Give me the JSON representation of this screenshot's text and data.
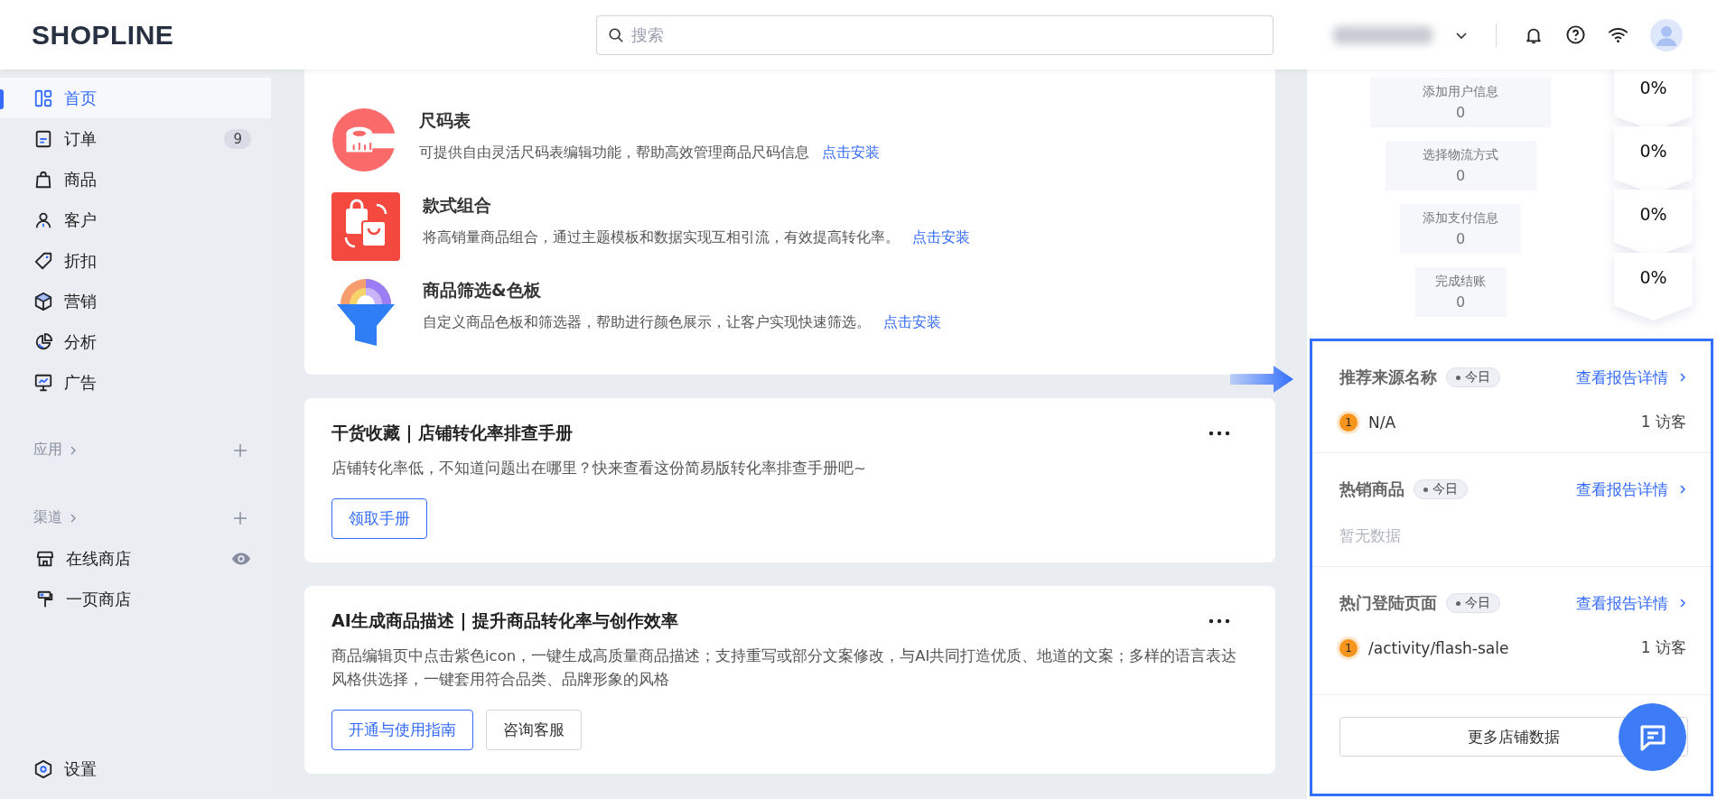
{
  "header": {
    "logo": "SHOPLINE",
    "search": {
      "placeholder": "搜索"
    }
  },
  "sidebar": {
    "items": [
      {
        "label": "首页",
        "selected": true
      },
      {
        "label": "订单",
        "selected": false,
        "badge": "9"
      },
      {
        "label": "商品",
        "selected": false
      },
      {
        "label": "客户",
        "selected": false
      },
      {
        "label": "折扣",
        "selected": false
      },
      {
        "label": "营销",
        "selected": false
      },
      {
        "label": "分析",
        "selected": false
      },
      {
        "label": "广告",
        "selected": false
      }
    ],
    "sections": [
      {
        "label": "应用"
      },
      {
        "label": "渠道",
        "children": [
          {
            "label": "在线商店",
            "preview": true
          },
          {
            "label": "一页商店",
            "preview": false
          }
        ]
      }
    ],
    "settings": "设置"
  },
  "plugins": [
    {
      "title": "尺码表",
      "description": "可提供自由灵活尺码表编辑功能，帮助高效管理商品尺码信息",
      "link": "点击安装"
    },
    {
      "title": "款式组合",
      "description": "将高销量商品组合，通过主题模板和数据实现互相引流，有效提高转化率。",
      "link": "点击安装"
    },
    {
      "title": "商品筛选&色板",
      "description": "自定义商品色板和筛选器，帮助进行颜色展示，让客户实现快速筛选。",
      "link": "点击安装"
    }
  ],
  "articles": [
    {
      "title": "干货收藏 | 店铺转化率排查手册",
      "description": "店铺转化率低，不知道问题出在哪里？快来查看这份简易版转化率排查手册吧~",
      "buttons": [
        {
          "label": "领取手册",
          "kind": "primary"
        }
      ]
    },
    {
      "title": "AI生成商品描述 | 提升商品转化率与创作效率",
      "description": "商品编辑页中点击紫色icon，一键生成高质量商品描述；支持重写或部分文案修改，与AI共同打造优质、地道的文案；多样的语言表达风格供选择，一键套用符合品类、品牌形象的风格",
      "buttons": [
        {
          "label": "开通与使用指南",
          "kind": "primary"
        },
        {
          "label": "咨询客服",
          "kind": "default"
        }
      ]
    }
  ],
  "funnel": [
    {
      "label": "添加用户信息",
      "value": "0",
      "rate": "0%"
    },
    {
      "label": "选择物流方式",
      "value": "0",
      "rate": "0%"
    },
    {
      "label": "添加支付信息",
      "value": "0",
      "rate": "0%"
    },
    {
      "label": "完成结账",
      "value": "0",
      "rate": "0%"
    }
  ],
  "reports": [
    {
      "title": "推荐来源名称",
      "tag": "今日",
      "link": "查看报告详情",
      "rows": [
        {
          "rank": "1",
          "name": "N/A",
          "count": "1 访客"
        }
      ]
    },
    {
      "title": "热销商品",
      "tag": "今日",
      "link": "查看报告详情",
      "empty": "暂无数据"
    },
    {
      "title": "热门登陆页面",
      "tag": "今日",
      "link": "查看报告详情",
      "rows": [
        {
          "rank": "1",
          "name": "/activity/flash-sale",
          "count": "1 访客"
        }
      ]
    }
  ],
  "more_button": "更多店铺数据"
}
